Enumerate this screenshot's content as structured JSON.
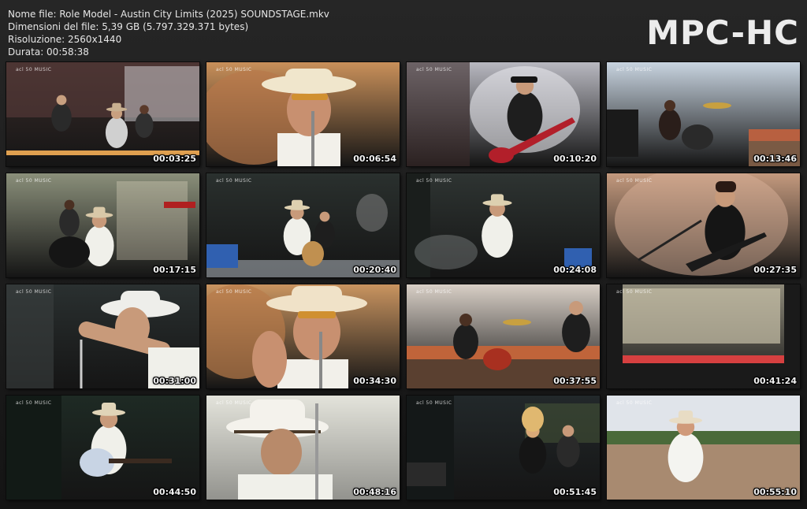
{
  "window": {
    "logo": "MPC-HC"
  },
  "file_info": {
    "name_line": "Nome file: Role Model - Austin City Limits (2025) SOUNDSTAGE.mkv",
    "size_line": "Dimensioni del file: 5,39 GB (5.797.329.371 bytes)",
    "resolution_line": "Risoluzione: 2560x1440",
    "duration_line": "Durata: 00:58:38"
  },
  "watermark": "acl 50 MUSIC",
  "thumbnails": [
    {
      "timestamp": "00:03:25",
      "scene": "stage-wide-band",
      "colors": {
        "bg": "#3a2c2a",
        "accent": "#c9a27a"
      }
    },
    {
      "timestamp": "00:06:54",
      "scene": "singer-closeup-hat",
      "colors": {
        "bg": "#c9905a",
        "accent": "#f0e6d0"
      }
    },
    {
      "timestamp": "00:10:20",
      "scene": "bassist-red-bass",
      "colors": {
        "bg": "#b8b8c0",
        "accent": "#b21f2a"
      }
    },
    {
      "timestamp": "00:13:46",
      "scene": "drummer-crowd-day",
      "colors": {
        "bg": "#c8d4e0",
        "accent": "#3a2a22"
      }
    },
    {
      "timestamp": "00:17:15",
      "scene": "singer-drummer-stage",
      "colors": {
        "bg": "#8a8f7a",
        "accent": "#e8e8e0"
      }
    },
    {
      "timestamp": "00:20:40",
      "scene": "band-dark-stage",
      "colors": {
        "bg": "#2a302e",
        "accent": "#e0ddd0"
      }
    },
    {
      "timestamp": "00:24:08",
      "scene": "singer-dark-stage",
      "colors": {
        "bg": "#2e3432",
        "accent": "#e8e4dc"
      }
    },
    {
      "timestamp": "00:27:35",
      "scene": "guitarist-warm-bg",
      "colors": {
        "bg": "#c49a7e",
        "accent": "#1e1e1e"
      }
    },
    {
      "timestamp": "00:31:00",
      "scene": "singer-bent-over",
      "colors": {
        "bg": "#2a3030",
        "accent": "#eeeeee"
      }
    },
    {
      "timestamp": "00:34:30",
      "scene": "singer-mic-closeup",
      "colors": {
        "bg": "#c99460",
        "accent": "#f0e2c8"
      }
    },
    {
      "timestamp": "00:37:55",
      "scene": "drummer-sunset-crowd",
      "colors": {
        "bg": "#d8cfc6",
        "accent": "#2a2420"
      }
    },
    {
      "timestamp": "00:41:24",
      "scene": "stage-wide-night",
      "colors": {
        "bg": "#8e8a7a",
        "accent": "#d64040"
      }
    },
    {
      "timestamp": "00:44:50",
      "scene": "singer-acoustic-guitar",
      "colors": {
        "bg": "#1e2a24",
        "accent": "#c8d4e4"
      }
    },
    {
      "timestamp": "00:48:16",
      "scene": "singer-hat-looking-down",
      "colors": {
        "bg": "#dcdcd4",
        "accent": "#4a3a2a"
      }
    },
    {
      "timestamp": "00:51:45",
      "scene": "dancers-dark-stage",
      "colors": {
        "bg": "#22282a",
        "accent": "#e0b870"
      }
    },
    {
      "timestamp": "00:55:10",
      "scene": "singer-crowd-outdoor",
      "colors": {
        "bg": "#c8d0d8",
        "accent": "#f4f4f0"
      }
    }
  ]
}
